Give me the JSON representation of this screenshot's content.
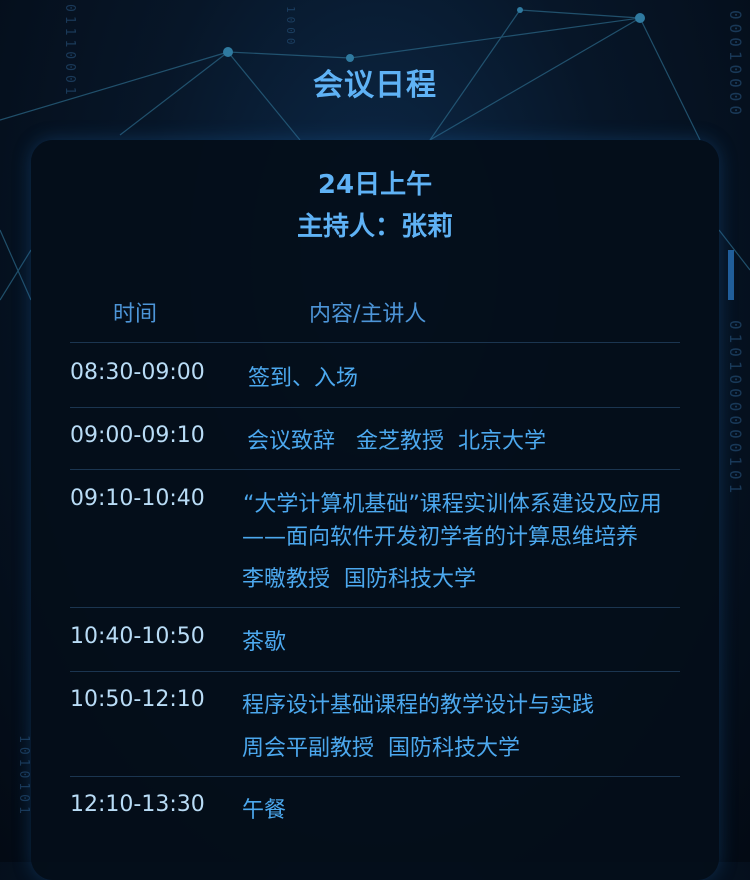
{
  "page_title": "会议日程",
  "session": {
    "title": "24日上午",
    "host": "主持人：张莉"
  },
  "table": {
    "headers": {
      "time": "时间",
      "content": "内容/主讲人"
    },
    "rows": [
      {
        "time": "08:30-09:00",
        "lines": [
          "签到、入场"
        ]
      },
      {
        "time": "09:00-09:10",
        "lines": [
          "会议致辞   金芝教授  北京大学"
        ]
      },
      {
        "time": "09:10-10:40",
        "lines": [
          "“大学计算机基础”课程实训体系建设及应用",
          "——面向软件开发初学者的计算思维培养",
          "李曒教授  国防科技大学"
        ]
      },
      {
        "time": "10:40-10:50",
        "lines": [
          "茶歇"
        ]
      },
      {
        "time": "10:50-12:10",
        "lines": [
          "程序设计基础课程的教学设计与实践",
          "周会平副教授  国防科技大学"
        ]
      },
      {
        "time": "12:10-13:30",
        "lines": [
          "午餐"
        ]
      }
    ]
  },
  "decor": {
    "binary_left": "01110001",
    "binary_left2": "1000",
    "binary_right": "00010000",
    "binary_right2": "0101000000101",
    "binary_bottom_left": "1010101"
  },
  "colors": {
    "accent": "#5fb2f5",
    "time_text": "#b9dcf6",
    "content_text": "#4ca8ee",
    "card_bg": "#040e1a"
  }
}
